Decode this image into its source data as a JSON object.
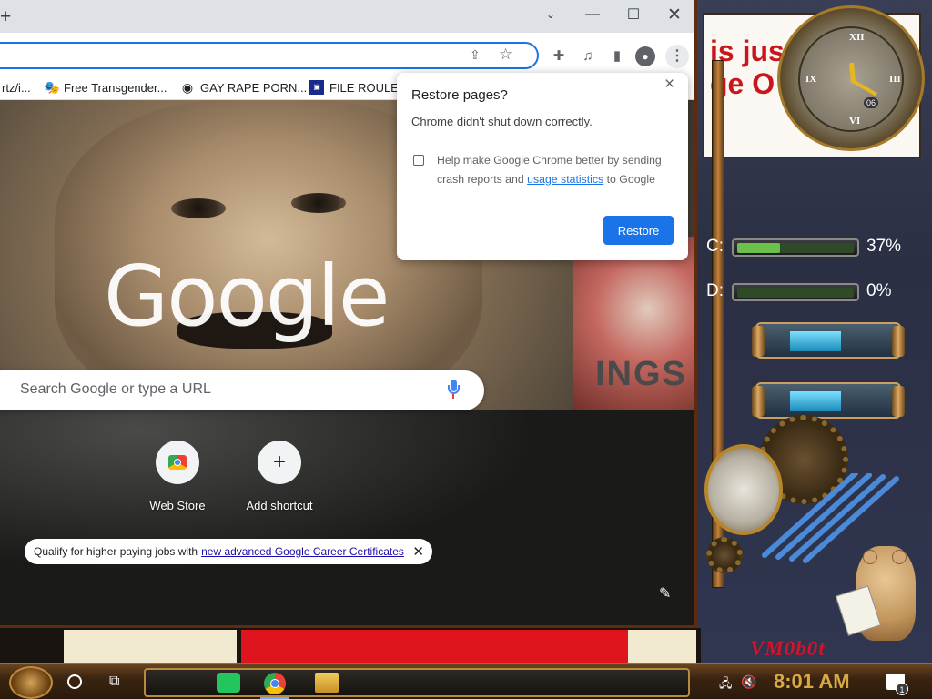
{
  "chrome": {
    "window_controls": {
      "chevron": "⌄",
      "minimize": "—",
      "maximize": "☐",
      "close": "✕"
    },
    "new_tab": "+",
    "bookmarks": [
      {
        "label": "rtz/i...",
        "icon": "page-icon"
      },
      {
        "label": "Free Transgender...",
        "icon": "masks-icon"
      },
      {
        "label": "GAY RAPE PORN...",
        "icon": "globe-icon"
      },
      {
        "label": "FILE ROULE",
        "icon": "mft-icon"
      }
    ]
  },
  "ntp": {
    "logo": "Google",
    "search_placeholder": "Search Google or type a URL",
    "shortcuts": [
      {
        "label": "Web Store"
      },
      {
        "label": "Add shortcut",
        "glyph": "+"
      }
    ],
    "careers_text": "Qualify for higher paying jobs with",
    "careers_link": "new advanced Google Career Certificates",
    "background_sign": "INGS"
  },
  "dialog": {
    "title": "Restore pages?",
    "message": "Chrome didn't shut down correctly.",
    "help_before": "Help make Google Chrome better by sending crash reports and",
    "help_link": "usage statistics",
    "help_after": "to Google",
    "button": "Restore",
    "checkbox_checked": false
  },
  "desktop": {
    "banner_line1": "is jus",
    "banner_line2": "ge O",
    "clock_date": "06",
    "drives": [
      {
        "letter": "C:",
        "percent": "37%",
        "fill": 0.37
      },
      {
        "letter": "D:",
        "percent": "0%",
        "fill": 0.0
      }
    ],
    "brand": "VM0b0t"
  },
  "taskbar": {
    "time": "8:01 AM",
    "notification_count": "1"
  },
  "colors": {
    "accent": "#1a73e8",
    "taskbar_time": "#d7a846",
    "banner_red": "#c8161c",
    "drive_fill": "#6bc04b"
  }
}
